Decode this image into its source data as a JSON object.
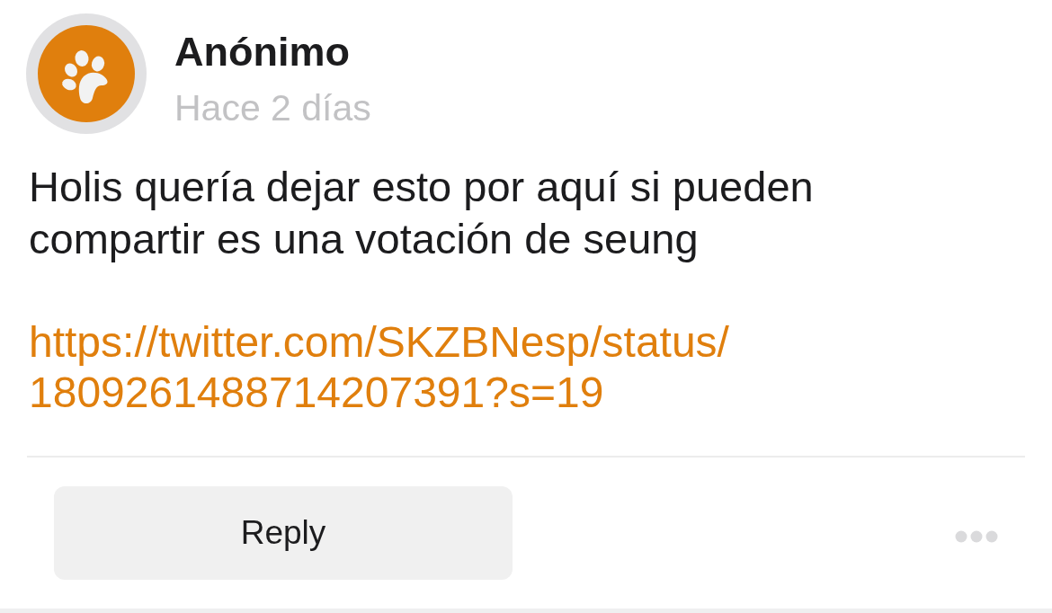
{
  "post": {
    "author": "Anónimo",
    "time": "Hace 2 días",
    "body": "Holis quería dejar esto por aquí si pueden compartir es una votación de seung",
    "link": "https://twitter.com/SKZBNesp/status/1809261488714207391?s=19"
  },
  "actions": {
    "reply_button": "Reply"
  }
}
